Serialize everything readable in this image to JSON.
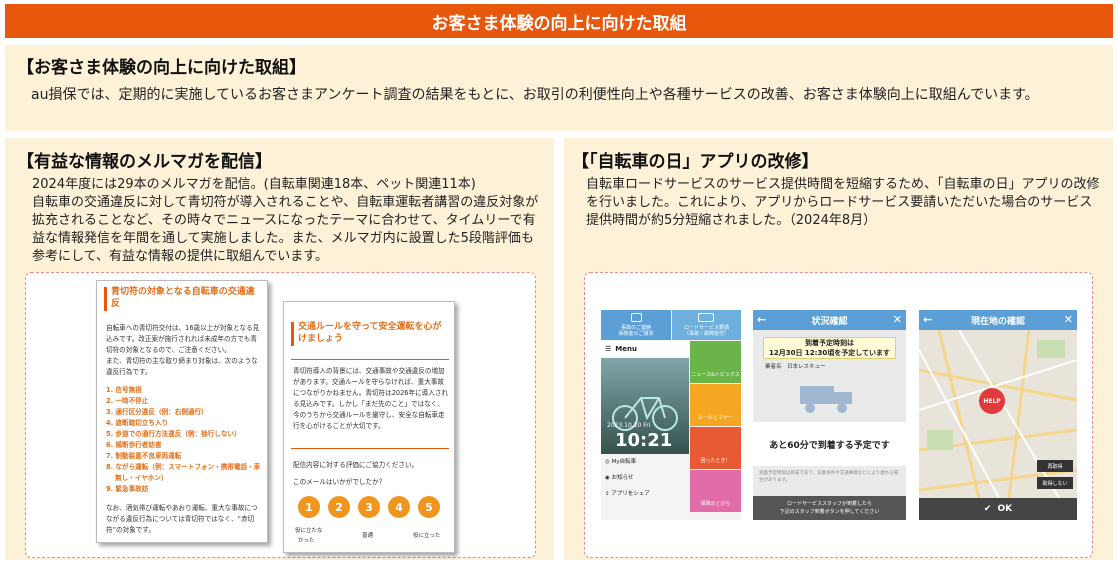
{
  "banner": {
    "title": "お客さま体験の向上に向けた取組"
  },
  "top": {
    "heading": "【お客さま体験の向上に向けた取組】",
    "body": "au損保では、定期的に実施しているお客さまアンケート調査の結果をもとに、お取引の利便性向上や各種サービスの改善、お客さま体験向上に取組んでいます。"
  },
  "left": {
    "heading": "【有益な情報のメルマガを配信】",
    "line1": "2024年度には29本のメルマガを配信。(自転車関連18本、ペット関連11本)",
    "body": "自転車の交通違反に対して青切符が導入されることや、自転車運転者講習の違反対象が拡充されることなど、その時々でニュースになったテーマに合わせて、タイムリーで有益な情報発信を年間を通して実施しました。また、メルマガ内に設置した5段階評価も参考にして、有益な情報の提供に取組んでいます。"
  },
  "card1": {
    "title": "青切符の対象となる自転車の交通違反",
    "p1": "自転車への青切符交付は、16歳以上が対象となる見込みです。改正案が施行されれば未成年の方でも青切符の対象となるので、ご注意ください。",
    "p2": "また、青切符の主な取り締まり対象は、次のような違反行為です。",
    "items": [
      "1. 信号無視",
      "2. 一時不停止",
      "3. 通行区分違反（例：右側通行）",
      "4. 遮断踏切立ち入り",
      "5. 歩道での通行方法違反（例：徐行しない）",
      "6. 横断歩行者妨害",
      "7. 制動装置不良車両運転",
      "8. ながら運転（例：スマートフォン・携帯電話・車",
      "無し・イヤホン）",
      "9. 緊急事故妨"
    ],
    "p3": "なお、酒気帯び運転やあおり運転、重大な事故につながる違反行為については青切符ではなく、“赤切符”の対象です。"
  },
  "card2": {
    "title": "交通ルールを守って安全運転を心がけましょう",
    "p1": "青切符導入の背景には、交通事故や交通違反の増加があります。交通ルールを守らなければ、重大事故につながりかねません。青切符は2026年に導入される見込みです。しかし「まだ先のこと」ではなく、今のうちから交通ルールを厳守し、安全な自転車走行を心がけることが大切です。",
    "p2": "配信内容に対する評価にご協力ください。",
    "q": "このメールはいかがでしたか？",
    "ratings": [
      "1",
      "2",
      "3",
      "4",
      "5"
    ],
    "low": "役に立たな",
    "low2": "かった",
    "mid": "普通",
    "high": "役に立った"
  },
  "right": {
    "heading": "【「自転車の日」アプリの改修】",
    "body": "自転車ロードサービスのサービス提供時間を短縮するため、「自転車の日」アプリの改修を行いました。これにより、アプリからロードサービス要請いただいた場合のサービス提供時間が約5分短縮されました。（2024年8月）"
  },
  "phone1": {
    "top_left": "事故のご連絡\n保険金のご請求",
    "top_right": "ロードサービス要請\n（事故・故障受付）",
    "menu": "Menu",
    "date": "2023.10.20 Fri",
    "time": "10:21",
    "my_bike": "My自転車",
    "notice": "お知らせ",
    "share": "アプリをシェア",
    "tile1": "ニュース&トピックス",
    "tile2": "ルールとマナー",
    "tile3": "困ったとき！",
    "tile4": "保険のとびら"
  },
  "phone2": {
    "title": "状況確認",
    "arrival_label": "到着予定時刻は",
    "arrival_time": "12月30日 12:30頃を予定しています",
    "company_label": "業者名",
    "company": "日本レスキュー",
    "eta": "あと60分で到着する予定です",
    "note": "到着予定時刻は目安であり、気象条件や交通事情などにより遅れる場合があります。",
    "footer": "ロードサービススタッフが到着したら\n下記のスタッフ到着ボタンを押してください"
  },
  "phone3": {
    "title": "現在地の確認",
    "help": "HELP",
    "btn1": "再取得",
    "btn2": "取得しない",
    "ok": "OK"
  },
  "colors": {
    "accent": "#e8580c",
    "panel": "#fdf1d8",
    "app_blue": "#5c9fd6"
  }
}
